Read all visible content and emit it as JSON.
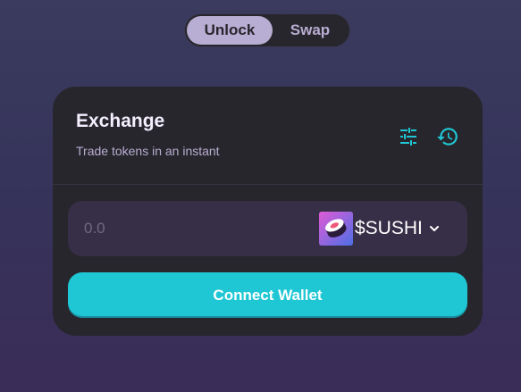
{
  "toggle": {
    "unlock_label": "Unlock",
    "swap_label": "Swap"
  },
  "card": {
    "title": "Exchange",
    "subtitle": "Trade tokens in an instant"
  },
  "input": {
    "placeholder": "0.0",
    "value": ""
  },
  "token": {
    "symbol": "$SUSHI",
    "logo_icon": "sushi-token-icon"
  },
  "connect_button": {
    "label": "Connect Wallet"
  },
  "colors": {
    "accent": "#1fc7d4",
    "card_bg": "#27262c",
    "input_bg": "#372f47",
    "text_primary": "#f4eeff",
    "text_secondary": "#b8add2"
  },
  "icons": [
    "settings-sliders-icon",
    "history-icon",
    "chevron-down-icon"
  ]
}
